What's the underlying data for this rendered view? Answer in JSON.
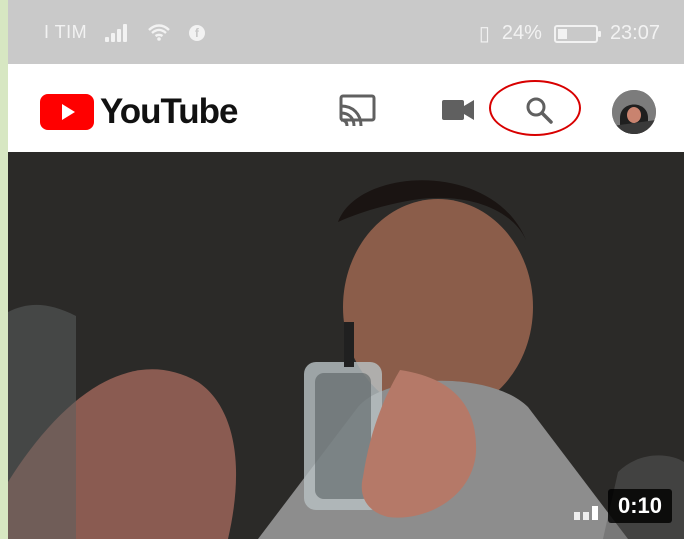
{
  "status_bar": {
    "carrier": "I TIM",
    "battery_percent": "24%",
    "time": "23:07",
    "battery_level": 0.24,
    "icons": {
      "signal": "signal-icon",
      "wifi": "wifi-icon",
      "facebook": "facebook-icon",
      "vibration": "vibration-icon",
      "battery": "battery-icon"
    }
  },
  "app_bar": {
    "logo_text": "YouTube",
    "icons": {
      "logo": "youtube-logo-icon",
      "cast": "cast-icon",
      "camera": "video-camera-icon",
      "search": "search-icon",
      "avatar": "avatar-icon"
    }
  },
  "video": {
    "duration": "0:10",
    "quality_icon": "signal-quality-icon"
  },
  "colors": {
    "brand_red": "#ff0000",
    "highlight_red": "#d80000"
  }
}
